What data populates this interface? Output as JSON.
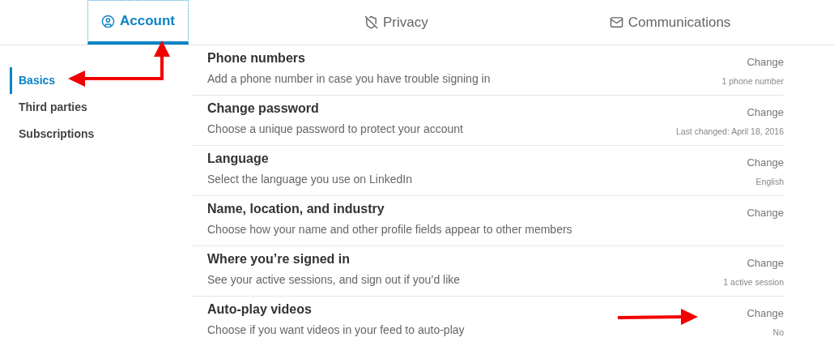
{
  "tabs": [
    {
      "label": "Account",
      "selected": true
    },
    {
      "label": "Privacy",
      "selected": false
    },
    {
      "label": "Communications",
      "selected": false
    }
  ],
  "sidebar": {
    "items": [
      {
        "label": "Basics",
        "selected": true
      },
      {
        "label": "Third parties",
        "selected": false
      },
      {
        "label": "Subscriptions",
        "selected": false
      }
    ]
  },
  "rows": [
    {
      "title": "Phone numbers",
      "description": "Add a phone number in case you have trouble signing in",
      "action": "Change",
      "detail": "1 phone number"
    },
    {
      "title": "Change password",
      "description": "Choose a unique password to protect your account",
      "action": "Change",
      "detail": "Last changed: April 18, 2016"
    },
    {
      "title": "Language",
      "description": "Select the language you use on LinkedIn",
      "action": "Change",
      "detail": "English"
    },
    {
      "title": "Name, location, and industry",
      "description": "Choose how your name and other profile fields appear to other members",
      "action": "Change"
    },
    {
      "title": "Where you’re signed in",
      "description": "See your active sessions, and sign out if you’d like",
      "action": "Change",
      "detail": "1 active session"
    },
    {
      "title": "Auto-play videos",
      "description": "Choose if you want videos in your feed to auto-play",
      "action": "Change",
      "detail": "No"
    }
  ]
}
